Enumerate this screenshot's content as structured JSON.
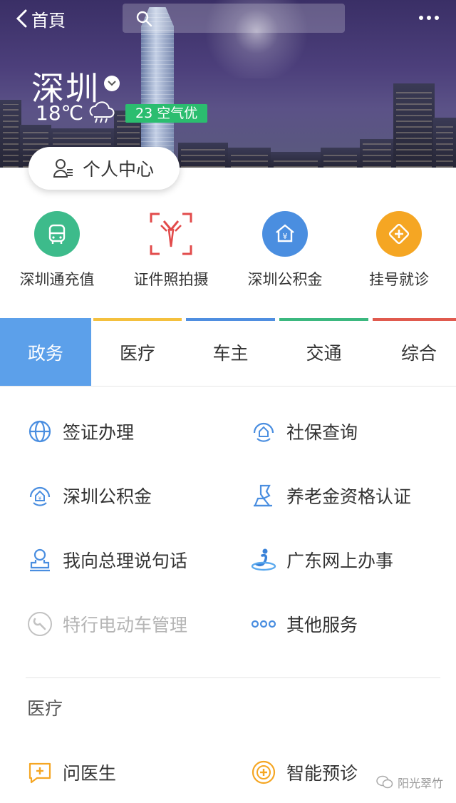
{
  "header": {
    "back_label": "首頁",
    "city": "深圳",
    "temperature": "18℃",
    "weather_icon": "cloud-rain-icon",
    "aqi_text": "23 空气优",
    "aqi_color": "#2bbd6f",
    "profile_label": "个人中心"
  },
  "quick_actions": [
    {
      "label": "深圳通充值",
      "icon": "bus-icon",
      "color": "#3dbb8b"
    },
    {
      "label": "证件照拍摄",
      "icon": "id-photo-icon",
      "color": "#e24b4b"
    },
    {
      "label": "深圳公积金",
      "icon": "housing-fund-icon",
      "color": "#4a8ee0"
    },
    {
      "label": "挂号就诊",
      "icon": "medical-plus-icon",
      "color": "#f5a623"
    }
  ],
  "tabs": [
    {
      "label": "政务",
      "active": true,
      "bar_color": ""
    },
    {
      "label": "医疗",
      "active": false,
      "bar_color": "#f4c03e"
    },
    {
      "label": "车主",
      "active": false,
      "bar_color": "#4f8ee0"
    },
    {
      "label": "交通",
      "active": false,
      "bar_color": "#3bb87f"
    },
    {
      "label": "综合",
      "active": false,
      "bar_color": "#e05a4e"
    }
  ],
  "services": [
    {
      "left": {
        "label": "签证办理",
        "icon": "globe-icon"
      },
      "right": {
        "label": "社保查询",
        "icon": "social-security-icon"
      }
    },
    {
      "left": {
        "label": "深圳公积金",
        "icon": "housing-fund-icon"
      },
      "right": {
        "label": "养老金资格认证",
        "icon": "person-pension-icon"
      }
    },
    {
      "left": {
        "label": "我向总理说句话",
        "icon": "stamp-person-icon"
      },
      "right": {
        "label": "广东网上办事",
        "icon": "guangdong-logo-icon"
      }
    },
    {
      "left": {
        "label": "特行电动车管理",
        "icon": "wrench-icon",
        "disabled": true
      },
      "right": {
        "label": "其他服务",
        "icon": "more-dots-icon"
      }
    }
  ],
  "medical_section": {
    "title": "医疗",
    "items": [
      {
        "label": "问医生",
        "icon": "chat-plus-icon"
      },
      {
        "label": "智能预诊",
        "icon": "plus-circle-icon"
      }
    ]
  },
  "watermark": "阳光翠竹",
  "colors": {
    "accent_blue": "#5ca0ea",
    "icon_blue": "#4a8ee0",
    "icon_orange": "#f5a623"
  }
}
